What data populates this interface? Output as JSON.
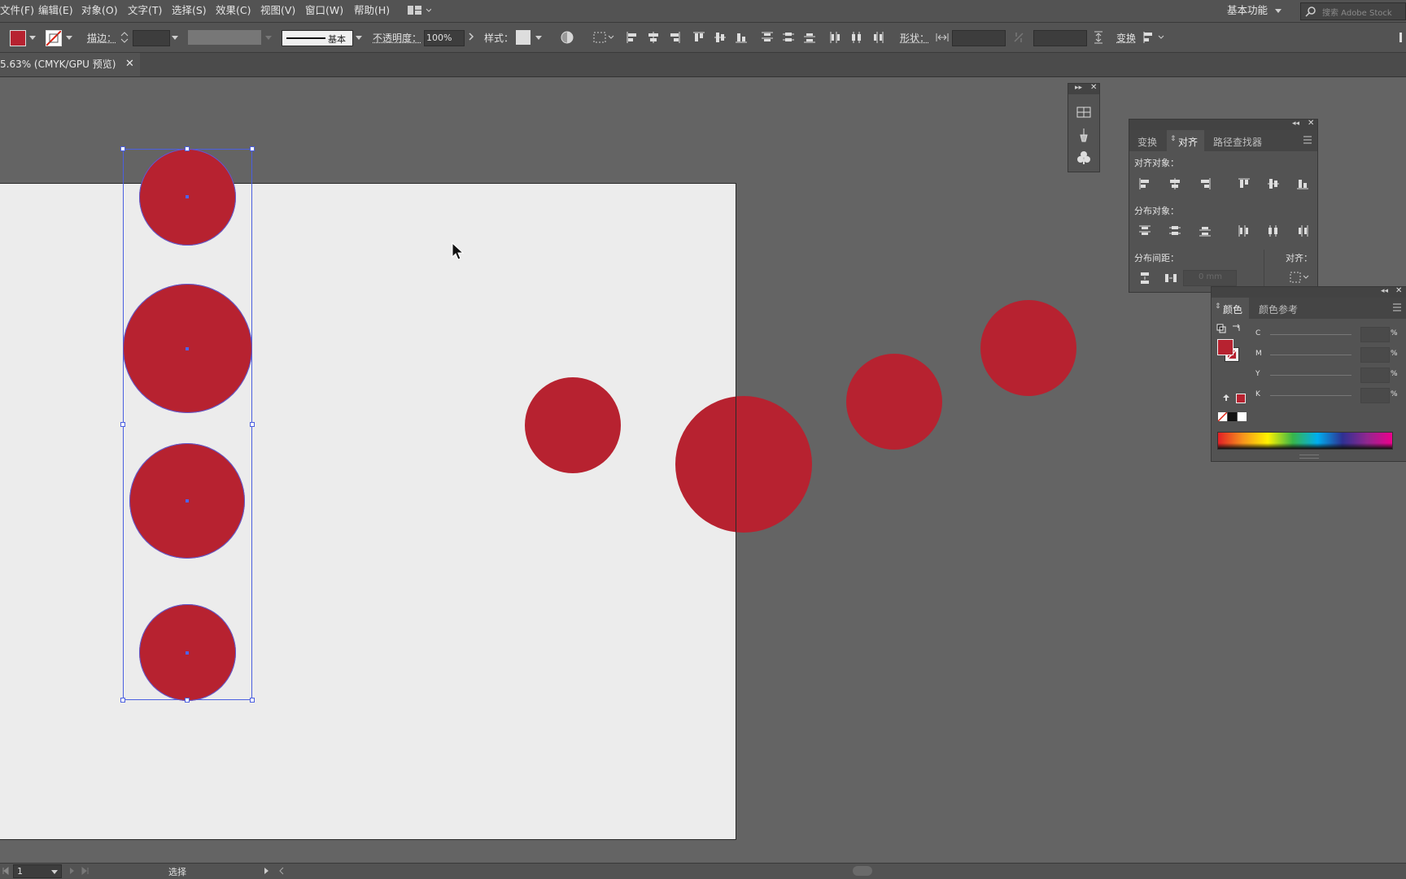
{
  "menubar": {
    "items": [
      "文件(F)",
      "编辑(E)",
      "对象(O)",
      "文字(T)",
      "选择(S)",
      "效果(C)",
      "视图(V)",
      "窗口(W)",
      "帮助(H)"
    ],
    "workspace": "基本功能",
    "search_placeholder": "搜索 Adobe Stock"
  },
  "control": {
    "stroke_label": "描边：",
    "stroke_profile": "基本",
    "opacity_label": "不透明度：",
    "opacity_value": "100%",
    "style_label": "样式：",
    "shape_label": "形状：",
    "transform_label": "变换"
  },
  "document": {
    "tab_title": "5.63% (CMYK/GPU 预览)"
  },
  "align_panel": {
    "tabs": [
      "变换",
      "对齐",
      "路径查找器"
    ],
    "align_objects_label": "对齐对象：",
    "distribute_objects_label": "分布对象：",
    "distribute_spacing_label": "分布间距：",
    "align_to_label": "对齐：",
    "spacing_value": "0 mm"
  },
  "color_panel": {
    "tabs": [
      "颜色",
      "颜色参考"
    ],
    "channels": [
      "C",
      "M",
      "Y",
      "K"
    ],
    "percent": "%"
  },
  "status": {
    "page_value": "1",
    "tool_name": "选择"
  },
  "colors": {
    "fill": "#b72230",
    "selection": "#4b5fe0",
    "artboard": "#ececec",
    "pasteboard": "#646464"
  }
}
